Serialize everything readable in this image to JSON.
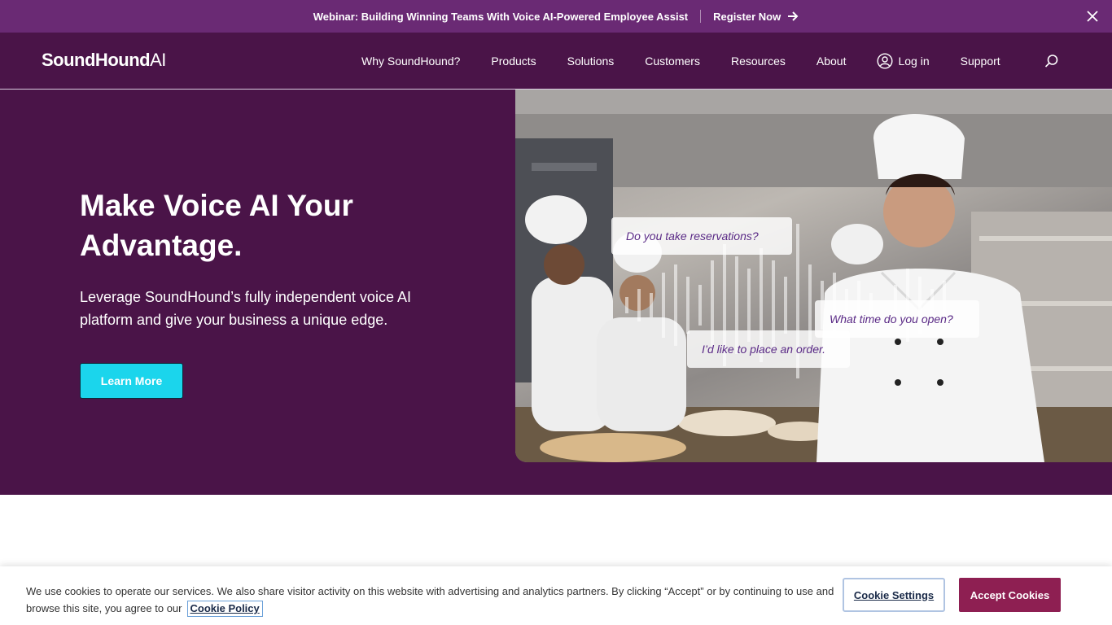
{
  "banner": {
    "message": "Webinar: Building Winning Teams With Voice AI-Powered Employee Assist",
    "cta": "Register Now"
  },
  "header": {
    "logo_main": "SoundHound",
    "logo_ai": "AI",
    "nav": [
      "Why SoundHound?",
      "Products",
      "Solutions",
      "Customers",
      "Resources",
      "About"
    ],
    "login": "Log in",
    "support": "Support"
  },
  "hero": {
    "title": "Make Voice AI Your Advantage.",
    "subtitle": "Leverage SoundHound’s fully independent voice AI platform and give your business a unique edge.",
    "button": "Learn More",
    "bubbles": [
      "Do you take reservations?",
      "What time do you open?",
      "I’d like to place an order."
    ]
  },
  "cookie": {
    "text": "We use cookies to operate our services. We also share visitor activity on this website with advertising and analytics partners. By clicking “Accept” or by continuing to use and browse this site, you agree to our",
    "policy": "Cookie Policy",
    "settings": "Cookie Settings",
    "accept": "Accept Cookies"
  },
  "colors": {
    "banner": "#6a2a74",
    "brand_purple": "#4a1448",
    "cta_cyan": "#1bd5ec",
    "accept_button": "#8e1f52"
  }
}
